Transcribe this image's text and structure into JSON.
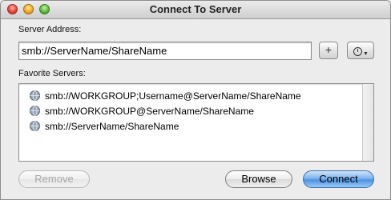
{
  "window": {
    "title": "Connect To Server"
  },
  "server_address": {
    "label": "Server Address:",
    "value": "smb://ServerName/ShareName"
  },
  "buttons": {
    "add": "+",
    "recent": "recent-servers-clock-icon",
    "remove": "Remove",
    "browse": "Browse",
    "connect": "Connect"
  },
  "favorites": {
    "label": "Favorite Servers:",
    "items": [
      "smb://WORKGROUP;Username@ServerName/ShareName",
      "smb://WORKGROUP@ServerName/ShareName",
      "smb://ServerName/ShareName"
    ]
  },
  "colors": {
    "connect_button": "#4c93e2",
    "close_light": "#e8473a",
    "minimize_light": "#f2a925",
    "zoom_light": "#61b93f"
  }
}
